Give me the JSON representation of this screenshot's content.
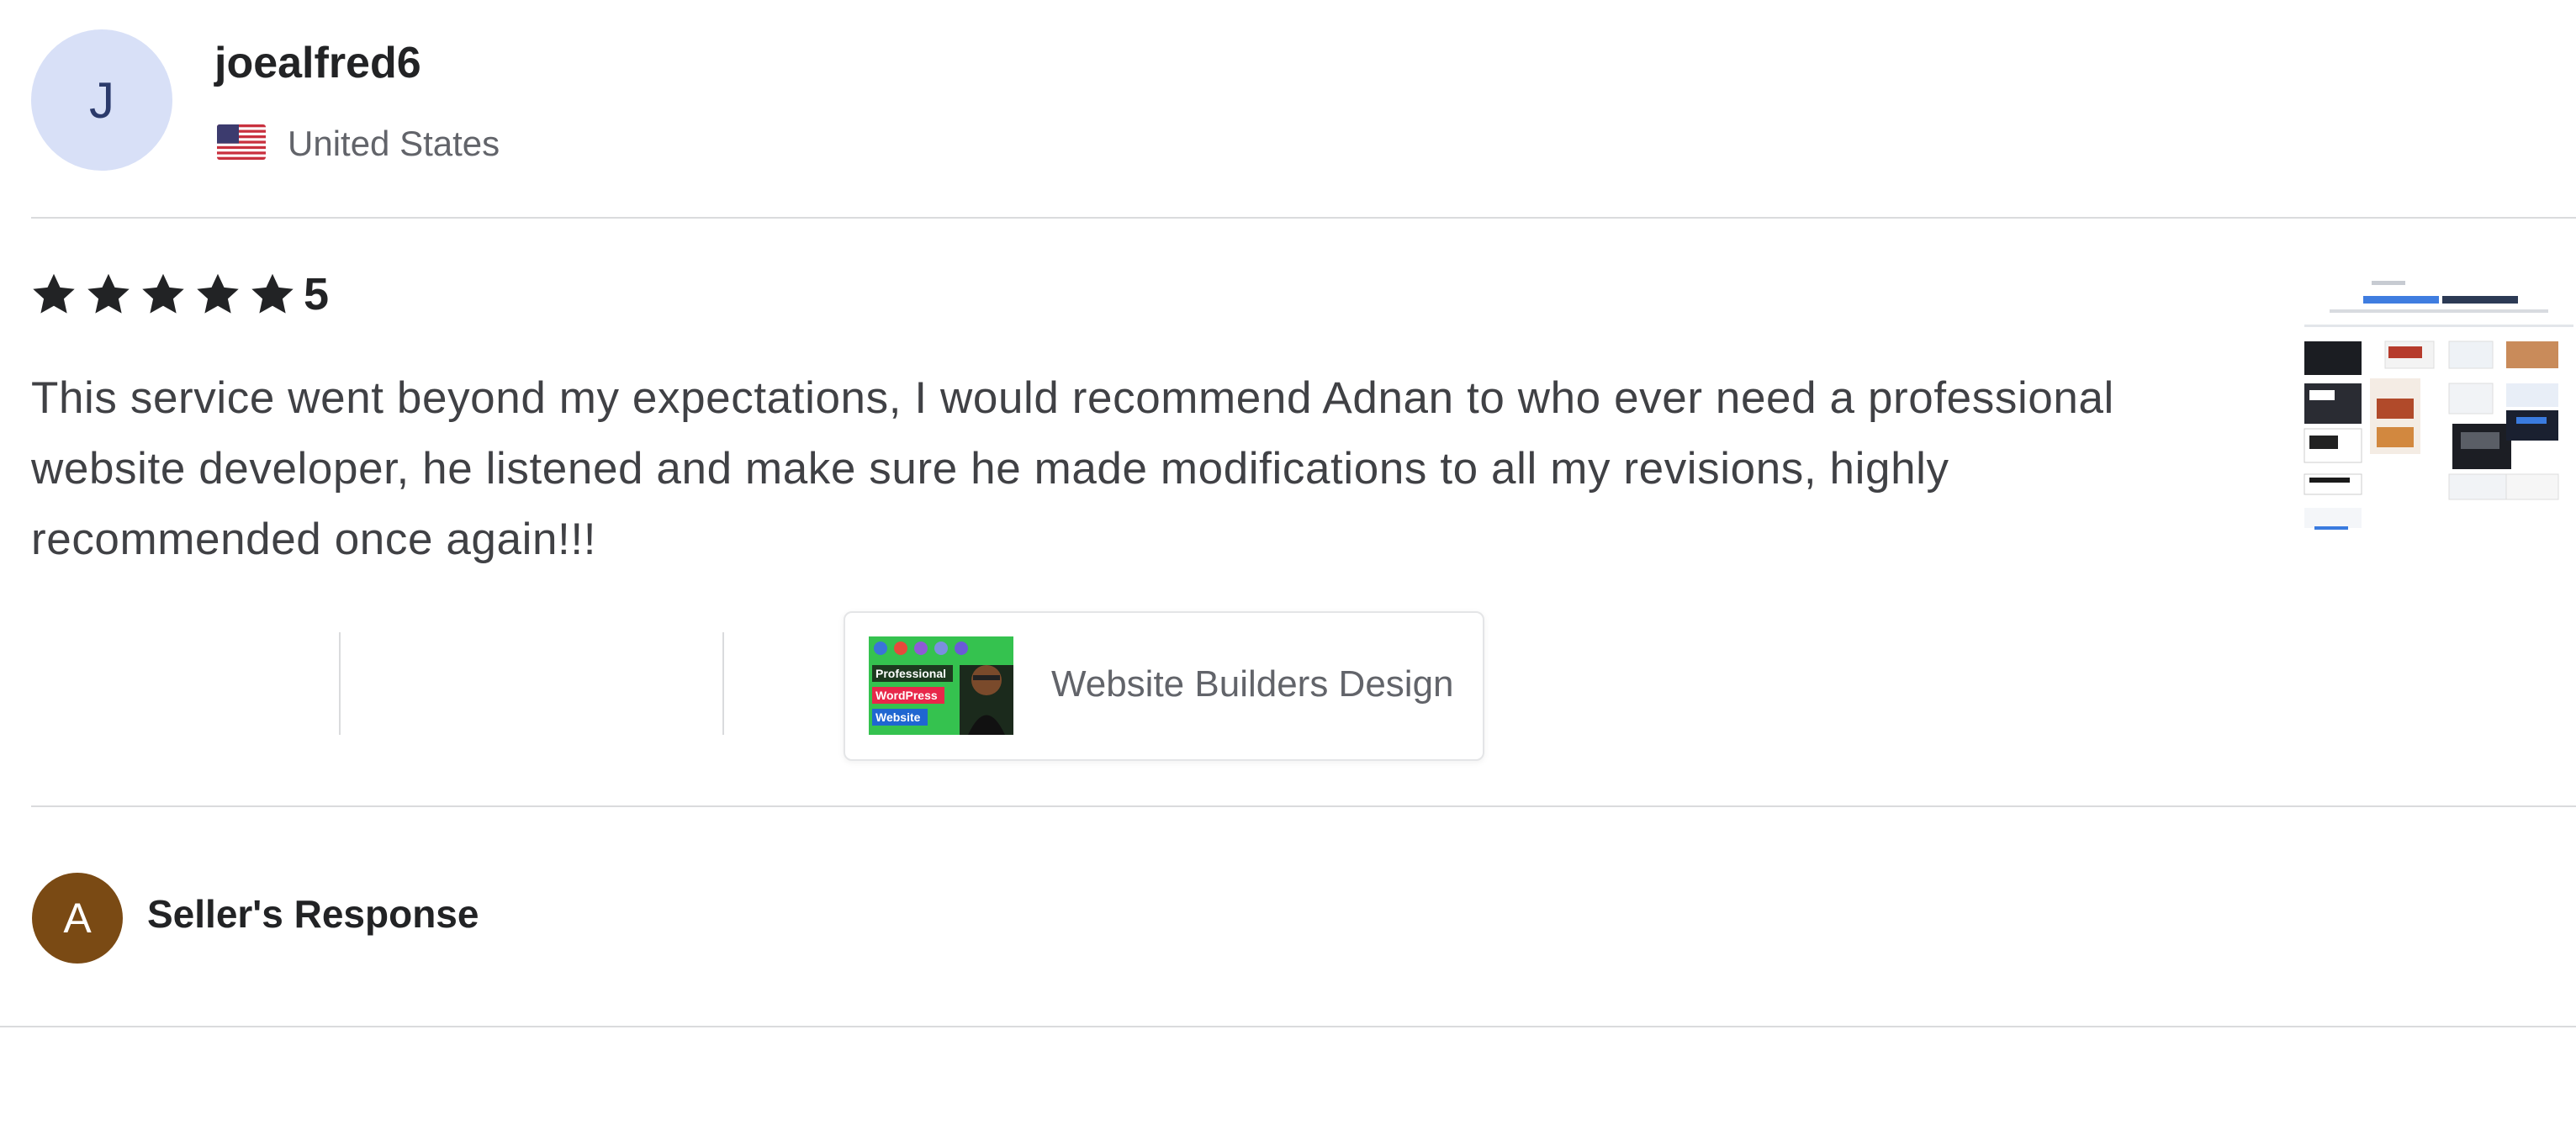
{
  "reviewer": {
    "initial": "J",
    "username": "joealfred6",
    "country": "United States",
    "flag_icon": "us-flag-icon"
  },
  "rating": {
    "stars": 5,
    "max_stars": 5,
    "value_label": "5",
    "star_color": "#222325"
  },
  "review": {
    "text": "This service went beyond my expectations, I would recommend Adnan to who ever need a professional website developer, he listened and make sure he made modifications to all my revisions, highly recommended once again!!!"
  },
  "gig": {
    "title": "Website Builders Design",
    "thumb_labels": [
      "Professional",
      "WordPress",
      "Website"
    ]
  },
  "seller_response": {
    "initial": "A",
    "label": "Seller's Response",
    "avatar_color": "#7a4a14"
  },
  "colors": {
    "divider": "#dadbdd",
    "text_muted": "#62646a",
    "avatar_bg": "#d8e0f7"
  }
}
